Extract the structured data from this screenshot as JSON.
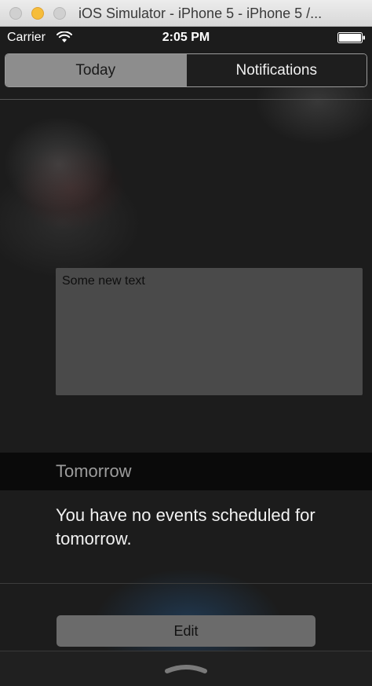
{
  "window": {
    "title": "iOS Simulator - iPhone 5 - iPhone 5 /..."
  },
  "status_bar": {
    "carrier": "Carrier",
    "time": "2:05 PM",
    "icons": [
      "wifi-icon",
      "battery-icon"
    ]
  },
  "tabs": [
    {
      "label": "Today",
      "selected": true
    },
    {
      "label": "Notifications",
      "selected": false
    }
  ],
  "widget": {
    "text": "Some new text"
  },
  "tomorrow": {
    "header": "Tomorrow",
    "message": "You have no events scheduled for tomorrow."
  },
  "edit_button": {
    "label": "Edit"
  },
  "bottom": {
    "icon": "grabber-chevron-icon"
  },
  "colors": {
    "background": "#1c1c1c",
    "segment_selected": "#8d8d8d",
    "widget_box": "#4a4a4a",
    "edit_button": "#6b6b6b"
  }
}
